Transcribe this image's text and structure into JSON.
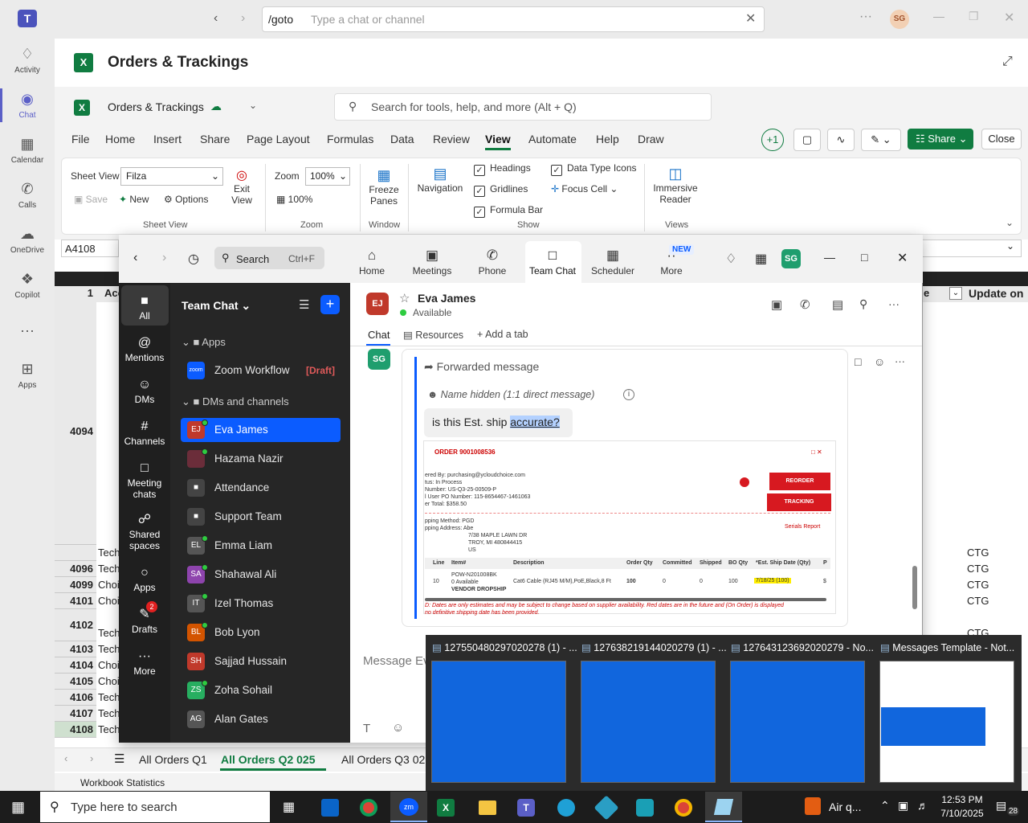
{
  "teams": {
    "goto": "/goto",
    "search_placeholder": "Type a chat or channel",
    "avatar": "SG",
    "rail": [
      {
        "label": "Activity",
        "icon": "bell-icon"
      },
      {
        "label": "Chat",
        "icon": "chat-icon"
      },
      {
        "label": "Calendar",
        "icon": "calendar-icon"
      },
      {
        "label": "Calls",
        "icon": "phone-icon"
      },
      {
        "label": "OneDrive",
        "icon": "cloud-icon"
      },
      {
        "label": "Copilot",
        "icon": "copilot-icon"
      },
      {
        "label": "Apps",
        "icon": "apps-icon"
      }
    ]
  },
  "excel": {
    "title": "Orders & Trackings",
    "doc_name": "Orders & Trackings",
    "search_placeholder": "Search for tools, help, and more (Alt + Q)",
    "tabs": [
      "File",
      "Home",
      "Insert",
      "Share",
      "Page Layout",
      "Formulas",
      "Data",
      "Review",
      "View",
      "Automate",
      "Help",
      "Draw"
    ],
    "active_tab": "View",
    "plus_count": "+1",
    "share_label": "Share",
    "close_label": "Close",
    "ribbon": {
      "sheet_view_label": "Sheet View",
      "sheet_view_value": "Filza",
      "save": "Save",
      "new": "New",
      "options": "Options",
      "exit_view": "Exit View",
      "group_sheet_view": "Sheet View",
      "zoom_label": "Zoom",
      "zoom_value": "100%",
      "zoom_100": "100%",
      "group_zoom": "Zoom",
      "freeze_panes": "Freeze Panes",
      "group_window": "Window",
      "navigation": "Navigation",
      "headings": "Headings",
      "gridlines": "Gridlines",
      "formula_bar": "Formula Bar",
      "data_type_icons": "Data Type Icons",
      "focus_cell": "Focus Cell",
      "group_show": "Show",
      "immersive_reader": "Immersive Reader",
      "group_views": "Views"
    },
    "name_box": "A4108",
    "header_row_num": "1",
    "header_a": "Acc",
    "header_right_1": "e",
    "header_right_2": "Update on",
    "rows": [
      {
        "num": "4094",
        "a": "",
        "r": ""
      },
      {
        "num": "",
        "a": "Tech",
        "r": "CTG"
      },
      {
        "num": "4096",
        "a": "Tech",
        "r": "CTG"
      },
      {
        "num": "4099",
        "a": "Choi",
        "r": "CTG"
      },
      {
        "num": "4101",
        "a": "Choi",
        "r": "CTG"
      },
      {
        "num": "4102",
        "a": "Tech",
        "r": "CTG"
      },
      {
        "num": "4103",
        "a": "Tech",
        "r": ""
      },
      {
        "num": "4104",
        "a": "Choi",
        "r": ""
      },
      {
        "num": "4105",
        "a": "Choi",
        "r": ""
      },
      {
        "num": "4106",
        "a": "Tech",
        "r": ""
      },
      {
        "num": "4107",
        "a": "Tech",
        "r": ""
      },
      {
        "num": "4108",
        "a": "Tech",
        "r": ""
      }
    ],
    "sheet_tabs": [
      "All Orders Q1",
      "All Orders Q2 025",
      "All Orders Q3 02"
    ],
    "status": "Workbook Statistics"
  },
  "zoom": {
    "search": "Search",
    "search_shortcut": "Ctrl+F",
    "nav": [
      {
        "label": "Home",
        "icon": "home-icon"
      },
      {
        "label": "Meetings",
        "icon": "video-icon"
      },
      {
        "label": "Phone",
        "icon": "phone-icon"
      },
      {
        "label": "Team Chat",
        "icon": "chat-icon"
      },
      {
        "label": "Scheduler",
        "icon": "calendar-icon"
      },
      {
        "label": "More",
        "icon": "more-icon"
      }
    ],
    "new_badge": "NEW",
    "avatar": "SG",
    "side": [
      {
        "label": "All",
        "icon": "chat-icon"
      },
      {
        "label": "Mentions",
        "icon": "at-icon"
      },
      {
        "label": "DMs",
        "icon": "people-icon"
      },
      {
        "label": "Channels",
        "icon": "hash-icon"
      },
      {
        "label": "Meeting chats",
        "icon": "meeting-icon"
      },
      {
        "label": "Shared spaces",
        "icon": "share-icon"
      },
      {
        "label": "Apps",
        "icon": "apps-icon"
      },
      {
        "label": "Drafts",
        "icon": "draft-icon",
        "badge": "2"
      },
      {
        "label": "More",
        "icon": "more-icon"
      }
    ],
    "list_title": "Team Chat",
    "section_apps": "Apps",
    "zoom_workflow": "Zoom Workflow",
    "draft_tag": "[Draft]",
    "section_dms": "DMs and channels",
    "contacts": [
      {
        "name": "Eva James",
        "init": "EJ",
        "color": "#c0392b",
        "selected": true,
        "online": true
      },
      {
        "name": "Hazama Nazir",
        "init": "",
        "color": "#6b2d3a",
        "online": true
      },
      {
        "name": "Attendance",
        "init": "🔒",
        "color": "#444"
      },
      {
        "name": "Support Team",
        "init": "🔒",
        "color": "#444"
      },
      {
        "name": "Emma Liam",
        "init": "EL",
        "color": "#555",
        "online": true
      },
      {
        "name": "Shahawal Ali",
        "init": "SA",
        "color": "#8e44ad",
        "online": true
      },
      {
        "name": "Izel Thomas",
        "init": "IT",
        "color": "#555",
        "online": true
      },
      {
        "name": "Bob Lyon",
        "init": "BL",
        "color": "#d35400",
        "online": true
      },
      {
        "name": "Sajjad Hussain",
        "init": "SH",
        "color": "#c0392b"
      },
      {
        "name": "Zoha Sohail",
        "init": "ZS",
        "color": "#27ae60",
        "online": true
      },
      {
        "name": "Alan Gates",
        "init": "AG",
        "color": "#555"
      }
    ],
    "chat": {
      "contact": "Eva James",
      "contact_init": "EJ",
      "status": "Available",
      "tab_chat": "Chat",
      "tab_resources": "Resources",
      "tab_add": "Add a tab",
      "sender_init": "SG",
      "forwarded": "Forwarded message",
      "hidden_name": "Name hidden (1:1 direct message)",
      "message_pre": "is this Est. ship ",
      "message_sel": "accurate?",
      "order_title": "ORDER 9001008536",
      "order_lines": [
        "ered By: purchasing@ycloudchoice.com",
        "tus: In Process",
        "Number: US-Q3-25-00509-P",
        "l User PO Number: 115-8654467-1461063",
        "er Total: $358.50"
      ],
      "ship_lines": [
        "pping Method: PGD",
        "pping Address: Abe",
        "7/38 MAPLE LAWN DR",
        "TROY, MI 480844415",
        "US"
      ],
      "reorder": "REORDER",
      "tracking": "TRACKING",
      "serials": "Serials Report",
      "table_headers": [
        "Line",
        "Item#",
        "Description",
        "Order Qty",
        "Committed",
        "Shipped",
        "BO Qty",
        "*Est. Ship Date (Qty)",
        "P"
      ],
      "table_row": [
        "10",
        "POW-N201008BK",
        "Cat6 Cable (RJ45 M/M),PoE,Black,8 Ft",
        "100",
        "0",
        "0",
        "100",
        "7/18/25 (100)",
        "$"
      ],
      "item_sub1": "0 Available",
      "item_sub2": "VENDOR DROPSHIP",
      "disclaimer": "D: Dates are only estimates and may be subject to change based on supplier availability. Red dates are in the future and (On Order) is displayed",
      "disclaimer2": "no definitive shipping date has been provided.",
      "compose_placeholder": "Message Ev"
    }
  },
  "thumbnails": [
    "127550480297020278 (1) - ...",
    "127638219144020279 (1) - ...",
    "127643123692020279 - No...",
    "Messages Template - Not..."
  ],
  "taskbar": {
    "search_placeholder": "Type here to search",
    "weather": "Air q...",
    "time": "12:53 PM",
    "date": "7/10/2025",
    "notif_count": "28"
  }
}
